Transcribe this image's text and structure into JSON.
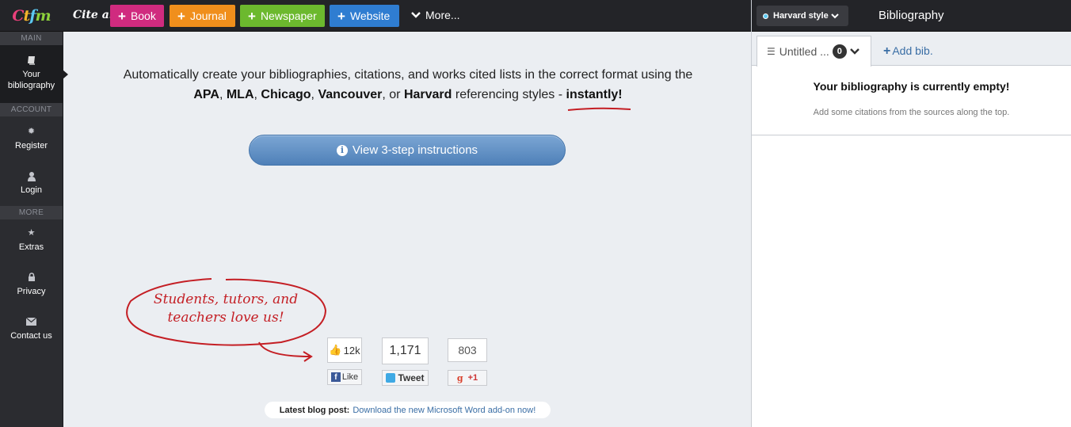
{
  "logo": {
    "letters": [
      "C",
      "t",
      "f",
      "m"
    ]
  },
  "topbar": {
    "cite_label": "Cite a:",
    "buttons": [
      {
        "label": "Book",
        "color": "#d02b7f"
      },
      {
        "label": "Journal",
        "color": "#f08f1c"
      },
      {
        "label": "Newspaper",
        "color": "#6cb92e"
      },
      {
        "label": "Website",
        "color": "#2f7dd1"
      }
    ],
    "more_label": "More..."
  },
  "sidebar": {
    "sections": [
      "MAIN",
      "ACCOUNT",
      "MORE"
    ],
    "items": [
      {
        "label": "Your bibliography",
        "icon": "book-icon"
      },
      {
        "label": "Register",
        "icon": "gear-icon"
      },
      {
        "label": "Login",
        "icon": "user-icon"
      },
      {
        "label": "Extras",
        "icon": "star-icon"
      },
      {
        "label": "Privacy",
        "icon": "lock-icon"
      },
      {
        "label": "Contact us",
        "icon": "envelope-icon"
      }
    ]
  },
  "main": {
    "intro_line1": "Automatically create your bibliographies, citations, and works cited lists in the correct format using the",
    "styles": [
      "APA",
      "MLA",
      "Chicago",
      "Vancouver",
      "Harvard"
    ],
    "sep_comma": ",",
    "sep_or": ", or",
    "intro_tail": "referencing styles -",
    "intro_emph": "instantly!",
    "instructions_button": "View 3-step instructions",
    "love_line1": "Students, tutors, and",
    "love_line2": "teachers love us!",
    "facebook": {
      "count": "12k",
      "action": "Like"
    },
    "twitter": {
      "count": "1,171",
      "action": "Tweet"
    },
    "google": {
      "count": "803",
      "action": "+1"
    },
    "blog_label": "Latest blog post:",
    "blog_link": "Download the new Microsoft Word add-on now!"
  },
  "right_panel": {
    "style_label": "Harvard style",
    "title": "Bibliography",
    "tab_label": "Untitled ...",
    "tab_count": "0",
    "add_bib": "Add bib.",
    "empty_title": "Your bibliography is currently empty!",
    "empty_hint": "Add some citations from the sources along the top."
  }
}
